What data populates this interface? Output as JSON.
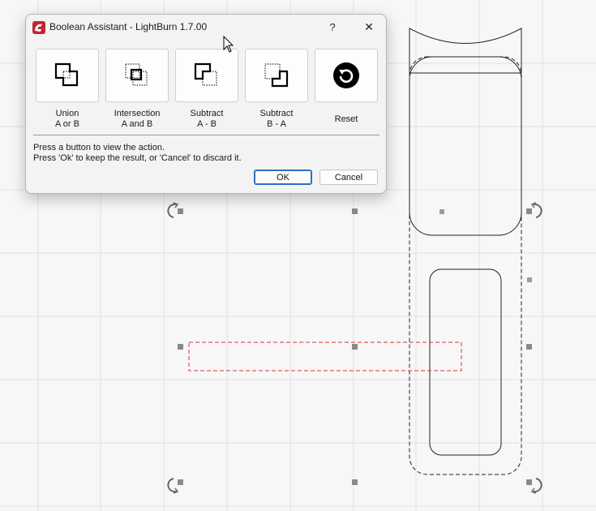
{
  "dialog": {
    "title": "Boolean Assistant - LightBurn 1.7.00",
    "help_label": "?",
    "close_label": "✕",
    "operations": [
      {
        "name": "union",
        "line1": "Union",
        "line2": "A or B"
      },
      {
        "name": "intersection",
        "line1": "Intersection",
        "line2": "A and B"
      },
      {
        "name": "subtract-a-b",
        "line1": "Subtract",
        "line2": "A - B"
      },
      {
        "name": "subtract-b-a",
        "line1": "Subtract",
        "line2": "B - A"
      },
      {
        "name": "reset",
        "line1": "",
        "line2": "Reset"
      }
    ],
    "help_line1": "Press a button to view the action.",
    "help_line2": "Press 'Ok' to keep the result, or 'Cancel' to discard it.",
    "ok_label": "OK",
    "cancel_label": "Cancel"
  },
  "colors": {
    "canvas_bg": "#f7f7f7",
    "grid": "#e2e2e2",
    "shape_stroke": "#222222",
    "selection_red": "#e0323a",
    "handle": "#8a8a8a",
    "logo_red": "#c0272d"
  },
  "icons": [
    "app-logo-icon",
    "union-icon",
    "intersection-icon",
    "subtract-a-b-icon",
    "subtract-b-a-icon",
    "reset-icon",
    "rotate-handle-icon",
    "mouse-cursor-icon"
  ]
}
